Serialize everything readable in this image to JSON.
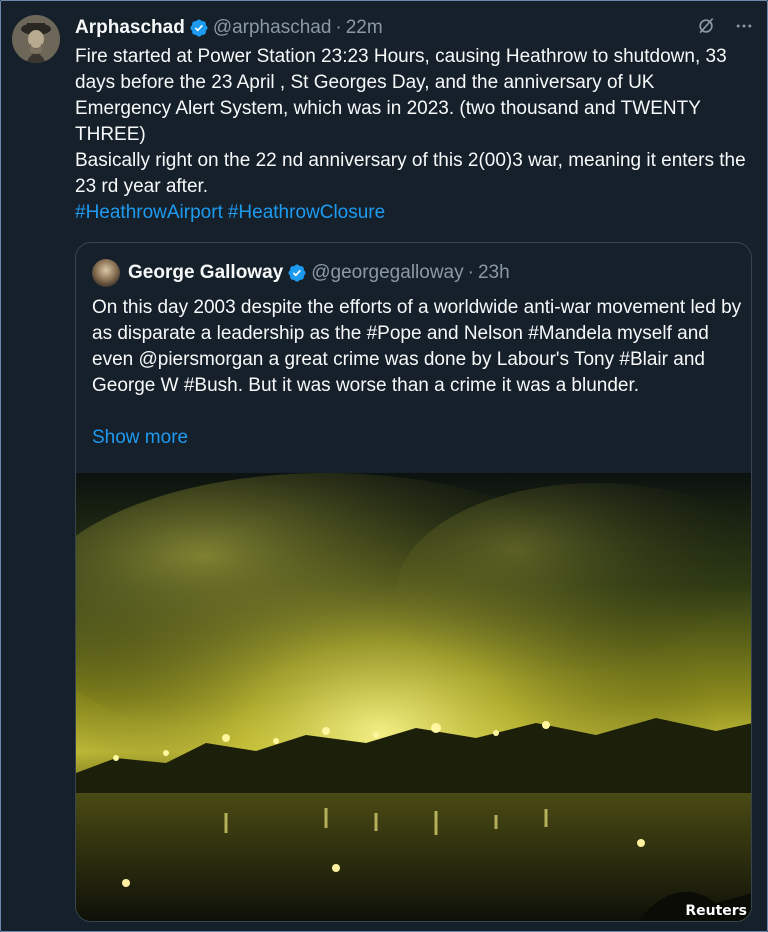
{
  "tweet": {
    "author_name": "Arphaschad",
    "handle": "@arphaschad",
    "separator": "·",
    "time": "22m",
    "text": "Fire started at Power Station 23:23 Hours, causing Heathrow to shutdown, 33 days before the 23 April , St Georges Day, and the anniversary of UK Emergency Alert System, which was in 2023. (two thousand and TWENTY THREE)\nBasically right on the 22 nd anniversary of this 2(00)3 war, meaning it enters the 23 rd year after.",
    "hashtags": [
      "#HeathrowAirport",
      "#HeathrowClosure"
    ],
    "icons": [
      "grok-icon",
      "more-icon"
    ]
  },
  "quoted": {
    "author_name": "George Galloway",
    "handle": "@georgegalloway",
    "separator": "·",
    "time": "23h",
    "text": "On this day 2003 despite the efforts of a worldwide anti-war movement led by as disparate a leadership as the #Pope and Nelson #Mandela myself and even @piersmorgan a great crime was done by Labour's Tony #Blair and George W #Bush. But it was worse than a crime it was a blunder.",
    "show_more": "Show more",
    "image_credit": "Reuters"
  },
  "colors": {
    "background": "#15202b",
    "link": "#1d9bf0",
    "verified": "#1d9bf0",
    "secondary_text": "#8b98a5"
  }
}
